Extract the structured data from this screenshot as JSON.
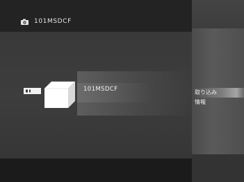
{
  "header": {
    "icon": "camera-icon",
    "title": "101MSDCF"
  },
  "device": {
    "icon": "memory-stick-reader-icon"
  },
  "folder": {
    "label": "101MSDCF",
    "selected": true
  },
  "options_menu": {
    "items": [
      {
        "label": "取り込み",
        "selected": true
      },
      {
        "label": "情報",
        "selected": false
      }
    ]
  },
  "colors": {
    "background": "#2b2b2b",
    "main_area": "#3b3b3b",
    "right_panel": "#4f4f4f",
    "text": "#f0f0f0"
  }
}
